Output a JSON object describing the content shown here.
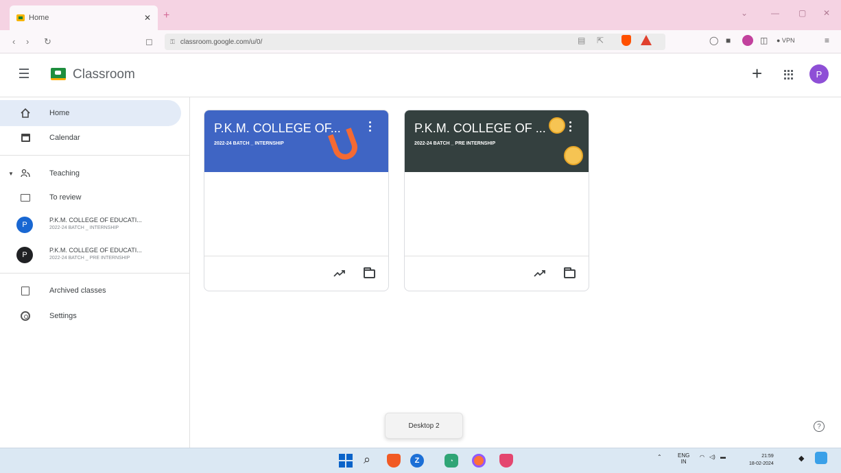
{
  "browser": {
    "tab_title": "Home",
    "tab_close": "✕",
    "new_tab": "+",
    "url": "classroom.google.com/u/0/",
    "vpn": "● VPN"
  },
  "header": {
    "app_title": "Classroom",
    "plus": "+",
    "avatar_letter": "P"
  },
  "sidebar": {
    "home": "Home",
    "calendar": "Calendar",
    "teaching": "Teaching",
    "to_review": "To review",
    "classes": [
      {
        "letter": "P",
        "name": "P.K.M. COLLEGE OF EDUCATI...",
        "sub": "2022-24 BATCH _ INTERNSHIP",
        "color": "#1967d2"
      },
      {
        "letter": "P",
        "name": "P.K.M. COLLEGE OF EDUCATI...",
        "sub": "2022-24 BATCH _ PRE INTERNSHIP",
        "color": "#202124"
      }
    ],
    "archived": "Archived classes",
    "settings": "Settings"
  },
  "cards": [
    {
      "title": "P.K.M. COLLEGE OF...",
      "subtitle": "2022-24 BATCH _ INTERNSHIP",
      "color": "#3f65c4"
    },
    {
      "title": "P.K.M. COLLEGE OF ...",
      "subtitle": "2022-24 BATCH _ PRE INTERNSHIP",
      "color": "#34403f"
    }
  ],
  "help": "?",
  "desktop_tooltip": "Desktop 2",
  "taskbar": {
    "lang": "ENG",
    "region": "IN",
    "time": "21:59",
    "date": "18-02-2024"
  }
}
